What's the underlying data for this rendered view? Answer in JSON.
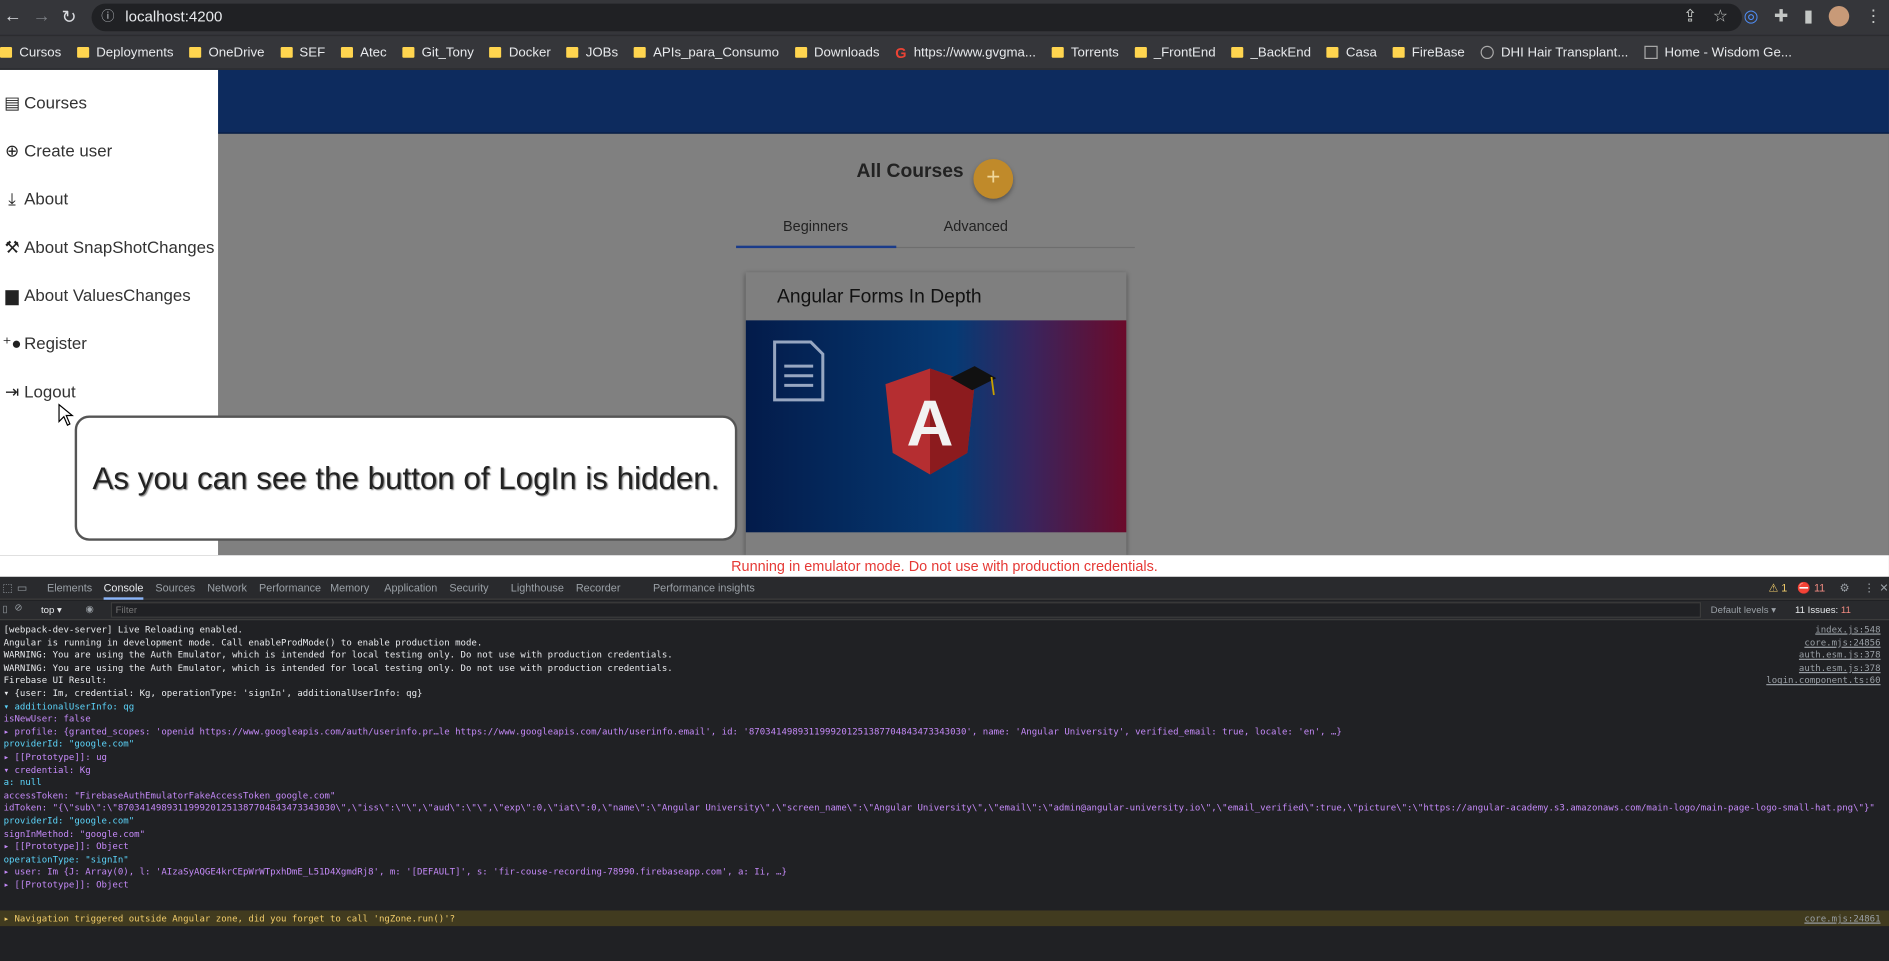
{
  "browser": {
    "url": "localhost:4200",
    "bookmarks": [
      "Cursos",
      "Deployments",
      "OneDrive",
      "SEF",
      "Atec",
      "Git_Tony",
      "Docker",
      "JOBs",
      "APIs_para_Consumo",
      "Downloads",
      "https://www.gvgma...",
      "Torrents",
      "_FrontEnd",
      "_BackEnd",
      "Casa",
      "FireBase",
      "DHI Hair Transplant...",
      "Home - Wisdom Ge..."
    ]
  },
  "sidenav": {
    "items": [
      {
        "label": "Courses",
        "icon": "library-books-icon"
      },
      {
        "label": "Create user",
        "icon": "add-circle-icon"
      },
      {
        "label": "About",
        "icon": "download-icon"
      },
      {
        "label": "About SnapShotChanges",
        "icon": "gavel-icon"
      },
      {
        "label": "About ValuesChanges",
        "icon": "forum-icon"
      },
      {
        "label": "Register",
        "icon": "person-add-icon"
      },
      {
        "label": "Logout",
        "icon": "logout-icon"
      }
    ]
  },
  "main": {
    "title": "All Courses",
    "fab_label": "+",
    "tabs": [
      "Beginners",
      "Advanced"
    ],
    "card_title": "Angular Forms In Depth",
    "card_letter": "A"
  },
  "callout": "As you can see the button of LogIn is hidden.",
  "emulator_note": "Running in emulator mode. Do not use with production credentials.",
  "devtools": {
    "tabs": [
      "Elements",
      "Console",
      "Sources",
      "Network",
      "Performance",
      "Memory",
      "Application",
      "Security",
      "Lighthouse",
      "Recorder",
      "Performance insights"
    ],
    "context": "top",
    "filter_placeholder": "Filter",
    "levels": "Default levels",
    "issues": "11 Issues:",
    "issues_count": "11",
    "warn_count": "1",
    "error_count": "11"
  },
  "console_lines": [
    {
      "text": "[webpack-dev-server] Live Reloading enabled.",
      "src": "index.js:548"
    },
    {
      "text": "Angular is running in development mode. Call enableProdMode() to enable production mode.",
      "src": "core.mjs:24856"
    },
    {
      "text": "WARNING: You are using the Auth Emulator, which is intended for local testing only.  Do not use with production credentials.",
      "src": "auth.esm.js:378"
    },
    {
      "text": "WARNING: You are using the Auth Emulator, which is intended for local testing only.  Do not use with production credentials.",
      "src": "auth.esm.js:378"
    },
    {
      "text": "Firebase UI Result:",
      "src": "login.component.ts:60"
    },
    {
      "text": "▾ {user: Im, credential: Kg, operationType: 'signIn', additionalUserInfo: qg}",
      "src": ""
    },
    {
      "text": "  ▾ additionalUserInfo: qg",
      "src": ""
    },
    {
      "text": "      isNewUser: false",
      "src": ""
    },
    {
      "text": "    ▸ profile: {granted_scopes: 'openid https://www.googleapis.com/auth/userinfo.pr…le https://www.googleapis.com/auth/userinfo.email', id: '870341498931199920125138770484347334303​0', name: 'Angular University', verified_email: true, locale: 'en', …}",
      "src": ""
    },
    {
      "text": "      providerId: \"google.com\"",
      "src": ""
    },
    {
      "text": "    ▸ [[Prototype]]: ug",
      "src": ""
    },
    {
      "text": "  ▾ credential: Kg",
      "src": ""
    },
    {
      "text": "      a: null",
      "src": ""
    },
    {
      "text": "      accessToken: \"FirebaseAuthEmulatorFakeAccessToken_google.com\"",
      "src": ""
    },
    {
      "text": "      idToken: \"{\\\"sub\\\":\\\"8703414989311999201251387704843473343030\\\",\\\"iss\\\":\\\"\\\",\\\"aud\\\":\\\"\\\",\\\"exp\\\":0,\\\"iat\\\":0,\\\"name\\\":\\\"Angular University\\\",\\\"screen_name\\\":\\\"Angular University\\\",\\\"email\\\":\\\"admin@angular-university.io\\\",\\\"email_verified\\\":true,\\\"picture\\\":\\\"https://angular-academy.s3.amazonaws.com/main-logo/main-page-logo-small-hat.png\\\"}\"",
      "src": ""
    },
    {
      "text": "      providerId: \"google.com\"",
      "src": ""
    },
    {
      "text": "      signInMethod: \"google.com\"",
      "src": ""
    },
    {
      "text": "    ▸ [[Prototype]]: Object",
      "src": ""
    },
    {
      "text": "    operationType: \"signIn\"",
      "src": ""
    },
    {
      "text": "  ▸ user: Im {J: Array(0), l: 'AIzaSyAQGE4krCEpWrWTpxhDmE_L51D4XgmdRj8', m: '[DEFAULT]', s: 'fir-couse-recording-78990.firebaseapp.com', a: Ii, …}",
      "src": ""
    },
    {
      "text": "  ▸ [[Prototype]]: Object",
      "src": ""
    }
  ],
  "console_warning": {
    "text": "▸ Navigation triggered outside Angular zone, did you forget to call 'ngZone.run()'?",
    "src": "core.mjs:24861"
  }
}
